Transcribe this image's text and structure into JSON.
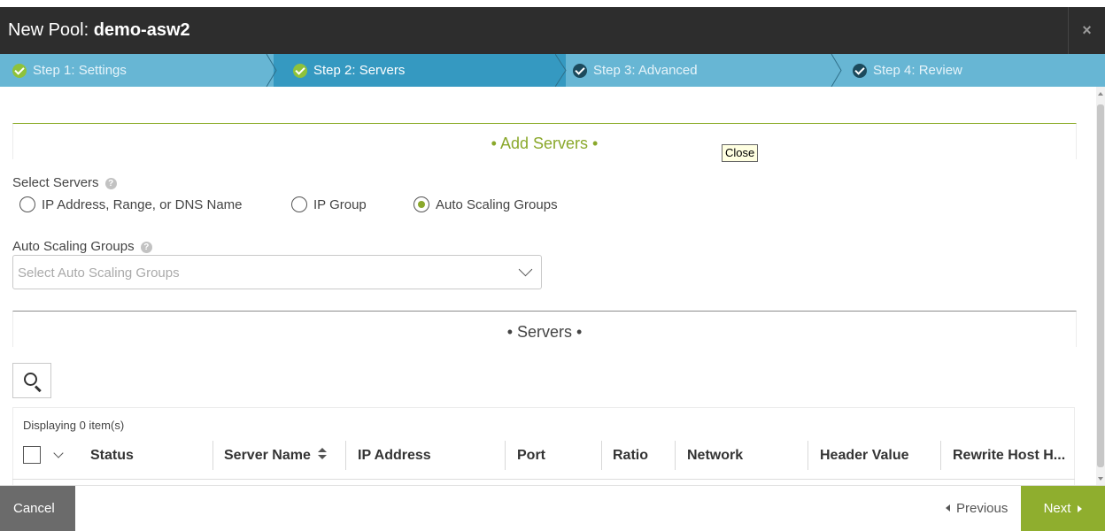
{
  "dialog": {
    "title_prefix": "New Pool:",
    "title_name": "demo-asw2",
    "close_symbol": "×"
  },
  "steps": [
    {
      "label": "Step 1: Settings",
      "state": "done"
    },
    {
      "label": "Step 2: Servers",
      "state": "active"
    },
    {
      "label": "Step 3: Advanced",
      "state": "todo"
    },
    {
      "label": "Step 4: Review",
      "state": "todo"
    }
  ],
  "add_servers": {
    "section_title": "• Add Servers •",
    "tooltip": "Close",
    "select_servers_label": "Select Servers",
    "radio_options": [
      {
        "label": "IP Address, Range, or DNS Name",
        "selected": false
      },
      {
        "label": "IP Group",
        "selected": false
      },
      {
        "label": "Auto Scaling Groups",
        "selected": true
      }
    ],
    "asg_label": "Auto Scaling Groups",
    "asg_placeholder": "Select Auto Scaling Groups"
  },
  "servers": {
    "section_title": "• Servers •",
    "displaying": "Displaying 0 item(s)",
    "columns": [
      "Status",
      "Server Name",
      "IP Address",
      "Port",
      "Ratio",
      "Network",
      "Header Value",
      "Rewrite Host H..."
    ]
  },
  "footer": {
    "cancel": "Cancel",
    "previous": "Previous",
    "next": "Next"
  },
  "colors": {
    "title_bar": "#2d2d2d",
    "step_bar": "#67b6d4",
    "step_active": "#3599c1",
    "accent_green": "#8fae2e",
    "cancel_gray": "#6b6b6b"
  }
}
